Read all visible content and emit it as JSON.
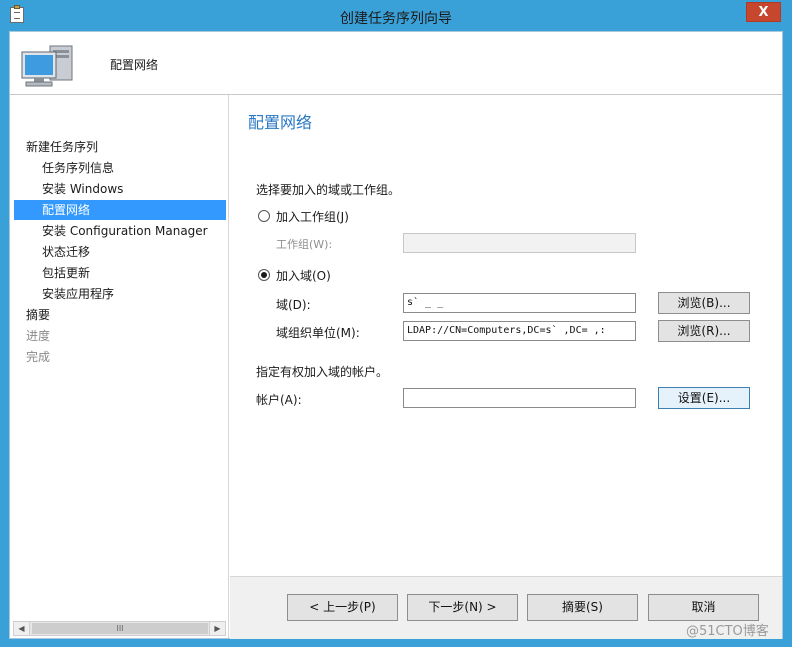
{
  "window": {
    "title": "创建任务序列向导",
    "close_glyph": "X"
  },
  "header": {
    "title": "配置网络",
    "icon": "computer-icon"
  },
  "sidebar": {
    "items": [
      {
        "label": "新建任务序列",
        "level": 0,
        "state": "normal"
      },
      {
        "label": "任务序列信息",
        "level": 1,
        "state": "normal"
      },
      {
        "label": "安装 Windows",
        "level": 1,
        "state": "normal"
      },
      {
        "label": "配置网络",
        "level": 1,
        "state": "selected"
      },
      {
        "label": "安装 Configuration Manager",
        "level": 1,
        "state": "normal"
      },
      {
        "label": "状态迁移",
        "level": 1,
        "state": "normal"
      },
      {
        "label": "包括更新",
        "level": 1,
        "state": "normal"
      },
      {
        "label": "安装应用程序",
        "level": 1,
        "state": "normal"
      },
      {
        "label": "摘要",
        "level": 0,
        "state": "normal"
      },
      {
        "label": "进度",
        "level": 0,
        "state": "disabled"
      },
      {
        "label": "完成",
        "level": 0,
        "state": "disabled"
      }
    ],
    "scrollbar_thumb_label": "III"
  },
  "main": {
    "heading": "配置网络",
    "prompt": "选择要加入的域或工作组。",
    "workgroup_radio_label": "加入工作组(J)",
    "workgroup_field_label": "工作组(W):",
    "workgroup_value": "",
    "domain_radio_label": "加入域(O)",
    "domain_field_label": "域(D):",
    "domain_value": "s`  _  _",
    "ou_field_label": "域组织单位(M):",
    "ou_value": "LDAP://CN=Computers,DC=s`  ,DC=  ,:",
    "browse_domain_button": "浏览(B)...",
    "browse_ou_button": "浏览(R)...",
    "account_prompt": "指定有权加入域的帐户。",
    "account_field_label": "帐户(A):",
    "account_value": "",
    "set_button": "设置(E)...",
    "selected_option": "domain"
  },
  "footer": {
    "prev_button": "< 上一步(P)",
    "next_button": "下一步(N) >",
    "summary_button": "摘要(S)",
    "cancel_button": "取消"
  },
  "watermark": "@51CTO博客",
  "colors": {
    "titlebar": "#3aa0d8",
    "selection": "#3399ff",
    "heading": "#2a78c5",
    "close": "#c7462e"
  }
}
